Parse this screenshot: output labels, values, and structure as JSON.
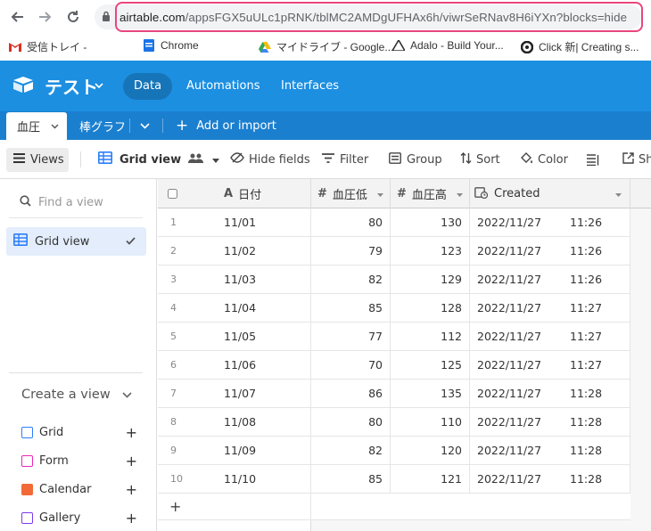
{
  "browser": {
    "url_host": "airtable.com",
    "url_path": "/appsFGX5uULc1pRNK/tblMC2AMDgUFHAx6h/viwrSeRNav8H6iYXn?blocks=hide",
    "bookmarks": [
      {
        "label": "受信トレイ -",
        "icon": "gmail-icon"
      },
      {
        "label": "Chrome",
        "icon": "chrome-docs-icon"
      },
      {
        "label": "マイドライブ - Google...",
        "icon": "drive-icon"
      },
      {
        "label": "Adalo - Build Your...",
        "icon": "adalo-icon"
      },
      {
        "label": "Click 新| Creating s...",
        "icon": "click-icon"
      }
    ]
  },
  "app": {
    "base_name": "テスト",
    "nav": [
      "Data",
      "Automations",
      "Interfaces"
    ]
  },
  "tables": {
    "active": "血圧",
    "other": "棒グラフ",
    "add_label": "Add or import"
  },
  "toolbar": {
    "views": "Views",
    "view_name": "Grid view",
    "hide_fields": "Hide fields",
    "filter": "Filter",
    "group": "Group",
    "sort": "Sort",
    "color": "Color",
    "share": "Sh"
  },
  "sidebar": {
    "find_placeholder": "Find a view",
    "current_view": "Grid view",
    "create_header": "Create a view",
    "create_items": [
      {
        "label": "Grid",
        "color": "#2d7ff9"
      },
      {
        "label": "Form",
        "color": "#e929ba"
      },
      {
        "label": "Calendar",
        "color": "#f26a36"
      },
      {
        "label": "Gallery",
        "color": "#7c39ed"
      }
    ]
  },
  "grid": {
    "columns": [
      "日付",
      "血圧低",
      "血圧高",
      "Created"
    ],
    "rows": [
      {
        "n": "1",
        "date": "11/01",
        "low": "80",
        "high": "130",
        "cdate": "2022/11/27",
        "ctime": "11:26"
      },
      {
        "n": "2",
        "date": "11/02",
        "low": "79",
        "high": "123",
        "cdate": "2022/11/27",
        "ctime": "11:26"
      },
      {
        "n": "3",
        "date": "11/03",
        "low": "82",
        "high": "129",
        "cdate": "2022/11/27",
        "ctime": "11:26"
      },
      {
        "n": "4",
        "date": "11/04",
        "low": "85",
        "high": "128",
        "cdate": "2022/11/27",
        "ctime": "11:27"
      },
      {
        "n": "5",
        "date": "11/05",
        "low": "77",
        "high": "112",
        "cdate": "2022/11/27",
        "ctime": "11:27"
      },
      {
        "n": "6",
        "date": "11/06",
        "low": "70",
        "high": "125",
        "cdate": "2022/11/27",
        "ctime": "11:27"
      },
      {
        "n": "7",
        "date": "11/07",
        "low": "86",
        "high": "135",
        "cdate": "2022/11/27",
        "ctime": "11:28"
      },
      {
        "n": "8",
        "date": "11/08",
        "low": "80",
        "high": "110",
        "cdate": "2022/11/27",
        "ctime": "11:28"
      },
      {
        "n": "9",
        "date": "11/09",
        "low": "82",
        "high": "120",
        "cdate": "2022/11/27",
        "ctime": "11:28"
      },
      {
        "n": "10",
        "date": "11/10",
        "low": "85",
        "high": "121",
        "cdate": "2022/11/27",
        "ctime": "11:28"
      }
    ],
    "add_row": "+"
  },
  "colors": {
    "header_blue": "#1c8fe1",
    "tables_blue": "#1b7fcf",
    "url_highlight": "#e8467c",
    "selected_view_bg": "#e3edfb"
  }
}
